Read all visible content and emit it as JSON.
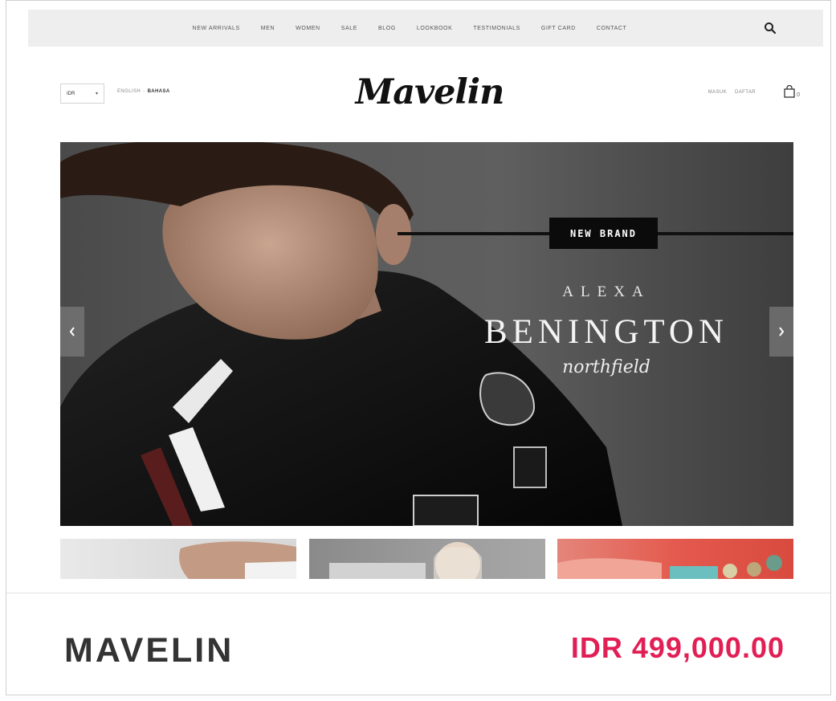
{
  "nav": {
    "items": [
      {
        "label": "NEW ARRIVALS"
      },
      {
        "label": "MEN"
      },
      {
        "label": "WOMEN"
      },
      {
        "label": "SALE"
      },
      {
        "label": "BLOG"
      },
      {
        "label": "LOOKBOOK"
      },
      {
        "label": "TESTIMONIALS"
      },
      {
        "label": "GIFT CARD"
      },
      {
        "label": "CONTACT"
      }
    ],
    "search_icon": "search-icon"
  },
  "header": {
    "currency": "IDR",
    "language": {
      "options": [
        "ENGLISH",
        "BAHASA"
      ],
      "active": "BAHASA"
    },
    "logo_text": "Mavelin",
    "account": {
      "login_label": "MASUK",
      "register_label": "DAFTAR"
    },
    "cart_count": "0",
    "cart_icon": "shopping-bag-icon"
  },
  "hero": {
    "badge": "NEW BRAND",
    "line1": "ALEXA",
    "line2": "BENINGTON",
    "line3": "northfield",
    "prev_icon": "chevron-left-icon",
    "next_icon": "chevron-right-icon"
  },
  "footer_bar": {
    "site_name": "MAVELIN",
    "price": "IDR 499,000.00",
    "price_color": "#e11f55"
  }
}
